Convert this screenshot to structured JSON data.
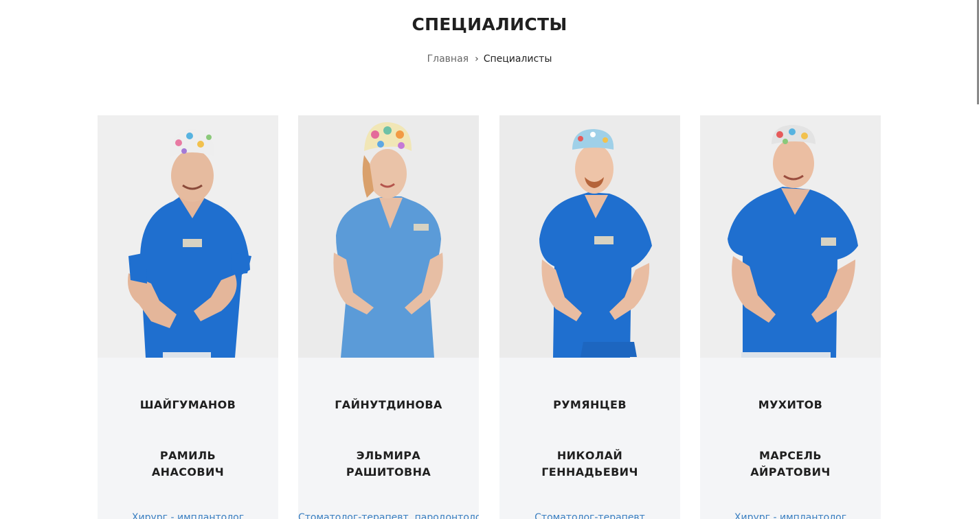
{
  "page": {
    "title": "СПЕЦИАЛИСТЫ",
    "breadcrumb": {
      "home": "Главная",
      "separator": "›",
      "current": "Специалисты"
    }
  },
  "colors": {
    "card_bg": "#f4f5f7",
    "role_link": "#3a7fc1",
    "scrub_blue": "#1f6fcf",
    "scrub_light_blue": "#5b9bd8"
  },
  "specialists": [
    {
      "surname": "ШАЙГУМАНОВ",
      "name_line1": "РАМИЛЬ",
      "name_line2": "АНАСОВИЧ",
      "role": "Хирург - имплантолог"
    },
    {
      "surname": "ГАЙНУТДИНОВА",
      "name_line1": "ЭЛЬМИРА",
      "name_line2": "РАШИТОВНА",
      "role": "Стоматолог-терапевт, пародонтолог"
    },
    {
      "surname": "РУМЯНЦЕВ",
      "name_line1": "НИКОЛАЙ",
      "name_line2": "ГЕННАДЬЕВИЧ",
      "role": "Стоматолог-терапевт"
    },
    {
      "surname": "МУХИТОВ",
      "name_line1": "МАРСЕЛЬ",
      "name_line2": "АЙРАТОВИЧ",
      "role": "Хирург - имплантолог"
    }
  ]
}
